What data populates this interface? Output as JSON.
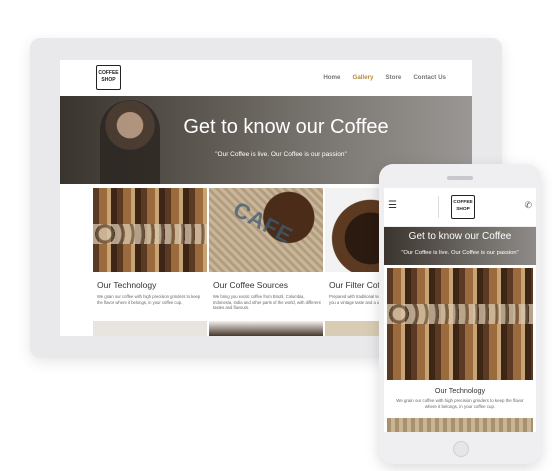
{
  "brand": {
    "logo_line1": "COFFEE",
    "logo_line2": "SHOP"
  },
  "nav": {
    "items": [
      "Home",
      "Gallery",
      "Store",
      "Contact Us"
    ],
    "active": "Gallery"
  },
  "hero": {
    "title": "Get to know our Coffee",
    "subtitle": "\"Our Coffee is live. Our Coffee is our passion\""
  },
  "tiles": [
    {
      "title": "Our Technology",
      "text": "We grain our coffee with high precision grinders to keep the flavor where it belongs, in your coffee cup."
    },
    {
      "title": "Our Coffee Sources",
      "text": "We bring you exotic coffee from Brazil, Columbia, Indonesia, India and other parts of the world, with different tastes and flavours."
    },
    {
      "title": "Our Filter Coffee",
      "text": "Prepared with traditional techniques, our filter coffee gives you a vintage taste and a unique experience."
    }
  ],
  "sack_text": "CAFE",
  "mobile": {
    "title": "Our Technology",
    "text": "We grain our coffee with high precision grinders to keep the flavor where it belongs, in your coffee cup."
  },
  "icons": {
    "menu": "hamburger-menu-icon",
    "phone": "phone-icon"
  },
  "colors": {
    "accent": "#b58c3c",
    "nav_text": "#777777"
  }
}
